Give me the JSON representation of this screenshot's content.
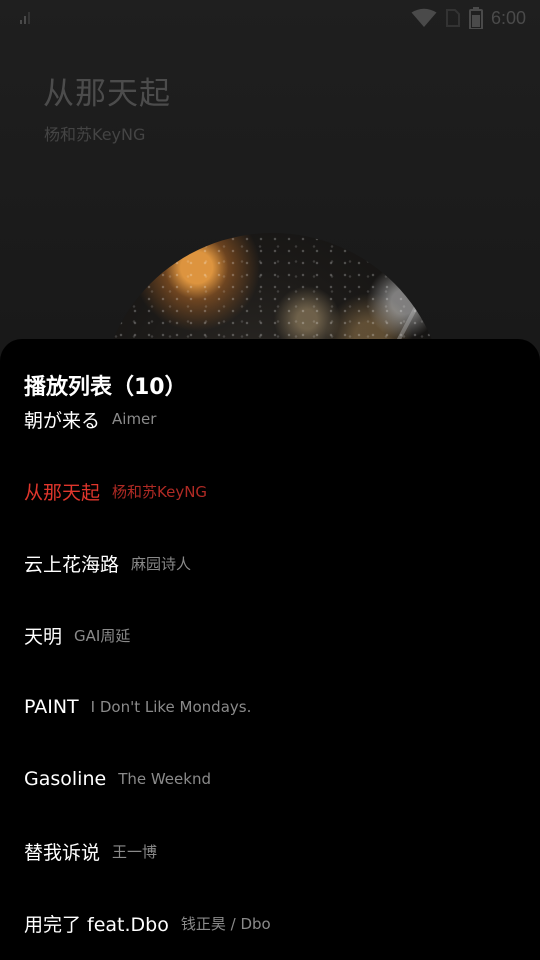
{
  "status_bar": {
    "time": "6:00",
    "icons": [
      "signal-strength-icon",
      "wifi-icon",
      "sim-off-icon",
      "battery-icon"
    ]
  },
  "now_playing": {
    "title": "从那天起",
    "artist": "杨和苏KeyNG"
  },
  "colors": {
    "accent": "#e0362c",
    "sheet_background": "#000000",
    "secondary_text": "#8a8a8a"
  },
  "playlist": {
    "title": "播放列表（10）",
    "items": [
      {
        "name": "朝が来る",
        "artist": "Aimer"
      },
      {
        "name": "从那天起",
        "artist": "杨和苏KeyNG",
        "playing": true
      },
      {
        "name": "云上花海路",
        "artist": "麻园诗人"
      },
      {
        "name": "天明",
        "artist": "GAI周延"
      },
      {
        "name": "PAINT",
        "artist": "I Don't Like Mondays."
      },
      {
        "name": "Gasoline",
        "artist": "The Weeknd"
      },
      {
        "name": "替我诉说",
        "artist": "王一博"
      },
      {
        "name": "用完了 feat.Dbo",
        "artist": "钱正昊 / Dbo"
      }
    ]
  }
}
